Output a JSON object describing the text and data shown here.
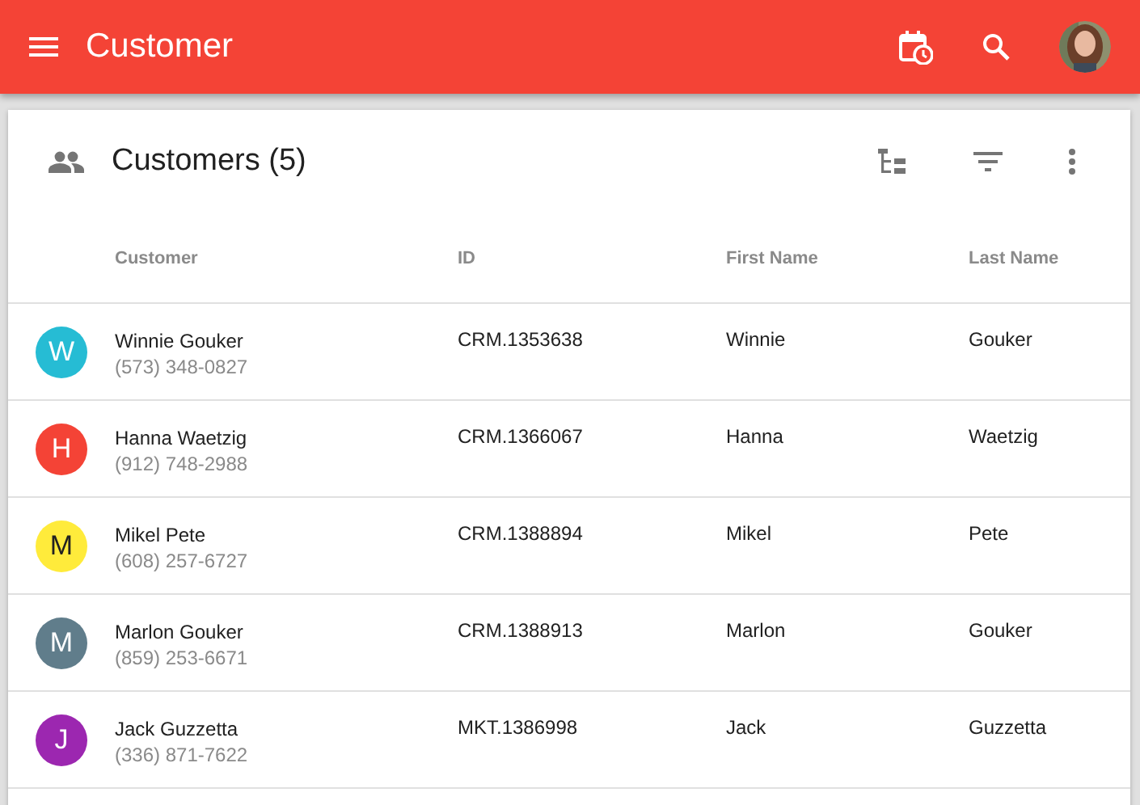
{
  "app_bar": {
    "title": "Customer"
  },
  "card": {
    "title": "Customers (5)"
  },
  "table": {
    "columns": [
      "Customer",
      "ID",
      "First Name",
      "Last Name"
    ],
    "rows": [
      {
        "initial": "W",
        "color": "#26bcd4",
        "name": "Winnie Gouker",
        "phone": "(573) 348-0827",
        "id": "CRM.1353638",
        "first_name": "Winnie",
        "last_name": "Gouker"
      },
      {
        "initial": "H",
        "color": "#f44336",
        "name": "Hanna Waetzig",
        "phone": "(912) 748-2988",
        "id": "CRM.1366067",
        "first_name": "Hanna",
        "last_name": "Waetzig"
      },
      {
        "initial": "M",
        "color": "#ffeb3b",
        "name": "Mikel Pete",
        "phone": "(608) 257-6727",
        "id": "CRM.1388894",
        "first_name": "Mikel",
        "last_name": "Pete"
      },
      {
        "initial": "M",
        "color": "#607d8b",
        "name": "Marlon Gouker",
        "phone": "(859) 253-6671",
        "id": "CRM.1388913",
        "first_name": "Marlon",
        "last_name": "Gouker"
      },
      {
        "initial": "J",
        "color": "#9c27b0",
        "name": "Jack Guzzetta",
        "phone": "(336) 871-7622",
        "id": "MKT.1386998",
        "first_name": "Jack",
        "last_name": "Guzzetta"
      }
    ]
  }
}
